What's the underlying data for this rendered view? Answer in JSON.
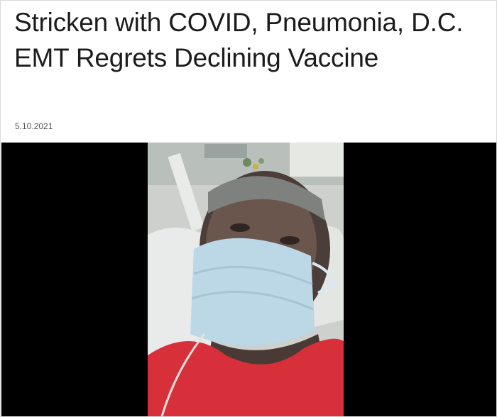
{
  "article": {
    "headline": "Stricken with COVID, Pneumonia, D.C. EMT Regrets Declining Vaccine",
    "date": "5.10.2021"
  },
  "media": {
    "still_description_icon": "video-still-image",
    "background_color": "#000000",
    "shirt_color": "#d8303a",
    "mask_color": "#bcd7e6"
  }
}
